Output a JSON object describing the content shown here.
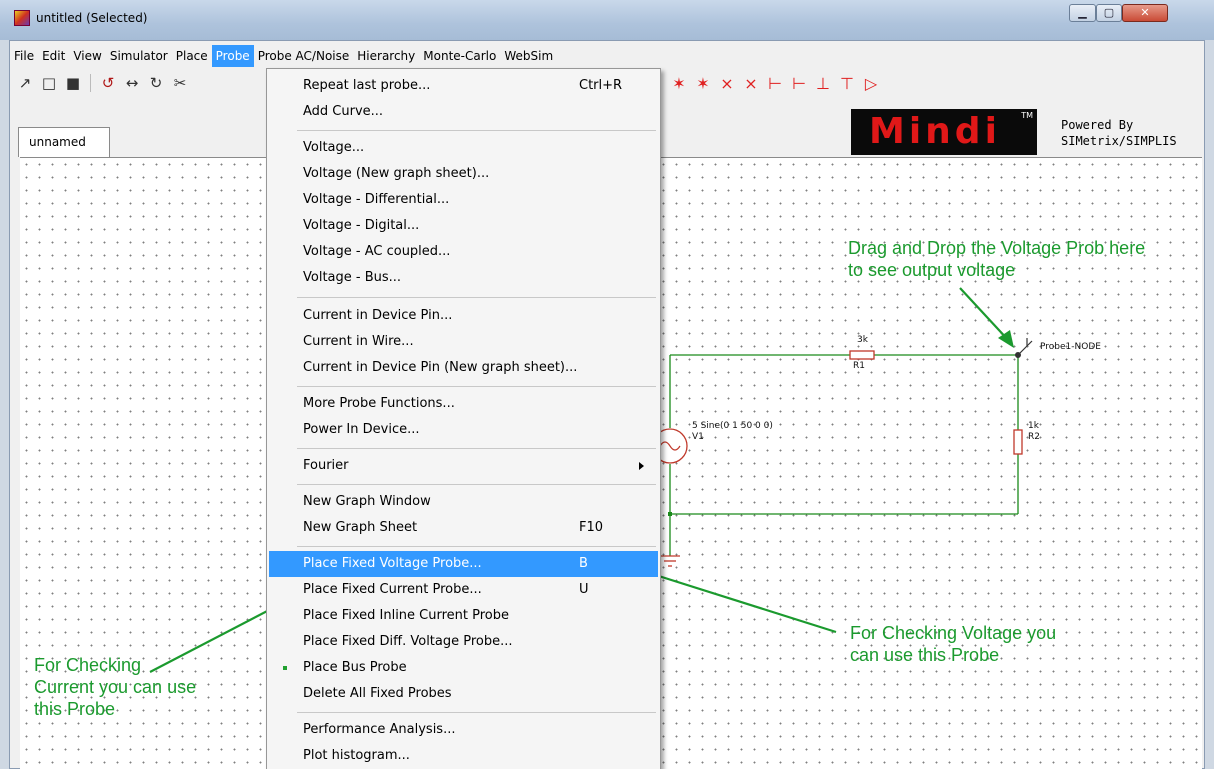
{
  "window": {
    "title": "untitled (Selected)",
    "min": "▁",
    "max": "▢",
    "close": "✕"
  },
  "menubar": [
    "File",
    "Edit",
    "View",
    "Simulator",
    "Place",
    "Probe",
    "Probe AC/Noise",
    "Hierarchy",
    "Monte-Carlo",
    "WebSim"
  ],
  "active_menu": "Probe",
  "toolbar_icons": [
    "open-icon",
    "new-icon",
    "save-icon",
    "undo-icon",
    "mirror-icon",
    "rotate-icon",
    "cut-icon"
  ],
  "tab": {
    "label": "unnamed"
  },
  "logo": {
    "text": "Mindi",
    "tm": "TM",
    "powered_line1": "Powered By",
    "powered_line2": "SIMetrix/SIMPLIS"
  },
  "probe_menu": {
    "items": [
      {
        "label": "Repeat last probe...",
        "shortcut": "Ctrl+R"
      },
      {
        "label": "Add Curve...",
        "shortcut": ""
      },
      {
        "label": "Voltage...",
        "shortcut": ""
      },
      {
        "label": "Voltage (New graph sheet)...",
        "shortcut": ""
      },
      {
        "label": "Voltage - Differential...",
        "shortcut": ""
      },
      {
        "label": "Voltage - Digital...",
        "shortcut": ""
      },
      {
        "label": "Voltage - AC coupled...",
        "shortcut": ""
      },
      {
        "label": "Voltage - Bus...",
        "shortcut": ""
      },
      {
        "label": "Current in Device Pin...",
        "shortcut": ""
      },
      {
        "label": "Current in Wire...",
        "shortcut": ""
      },
      {
        "label": "Current in Device Pin (New graph sheet)...",
        "shortcut": ""
      },
      {
        "label": "More Probe Functions...",
        "shortcut": ""
      },
      {
        "label": "Power In Device...",
        "shortcut": ""
      },
      {
        "label": "Fourier",
        "shortcut": ""
      },
      {
        "label": "New Graph Window",
        "shortcut": ""
      },
      {
        "label": "New Graph Sheet",
        "shortcut": "F10"
      },
      {
        "label": "Place Fixed Voltage Probe...",
        "shortcut": "B"
      },
      {
        "label": "Place Fixed Current Probe...",
        "shortcut": "U"
      },
      {
        "label": "Place Fixed Inline Current Probe",
        "shortcut": ""
      },
      {
        "label": "Place Fixed Diff. Voltage Probe...",
        "shortcut": ""
      },
      {
        "label": "Place Bus Probe",
        "shortcut": ""
      },
      {
        "label": "Delete All Fixed Probes",
        "shortcut": ""
      },
      {
        "label": "Performance Analysis...",
        "shortcut": ""
      },
      {
        "label": "Plot histogram...",
        "shortcut": ""
      }
    ]
  },
  "schematic": {
    "r1_value": "3k",
    "r1_name": "R1",
    "r2_value": "1k",
    "r2_name": "R2",
    "v1_value": "5 Sine(0 1 50 0 0)",
    "v1_name": "V1",
    "probe_label": "Probe1-NODE"
  },
  "annotations": {
    "voltage_probe_drop_1": "Drag and Drop the Voltage Prob here",
    "voltage_probe_drop_2": "to see output voltage",
    "check_voltage_1": "For Checking Voltage you",
    "check_voltage_2": "can use this Probe",
    "check_current_1": "For Checking",
    "check_current_2": "Current you can use",
    "check_current_3": "this Probe"
  },
  "colors": {
    "accent": "#3399ff",
    "wire": "#1a8a1a",
    "annotation": "#1b9a2e",
    "logo": "#e01818"
  }
}
